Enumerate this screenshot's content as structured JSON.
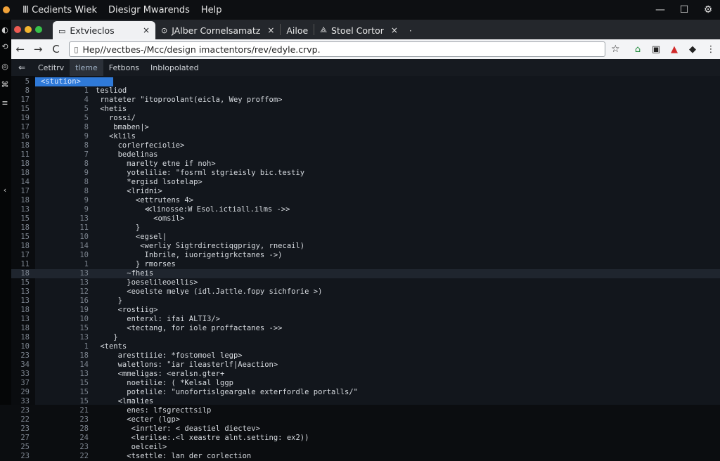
{
  "menubar": {
    "items": [
      "Ⅲ Cedients Wiek",
      "Diesigr Mwarends",
      "Help"
    ]
  },
  "window_controls": {
    "minimize": "—",
    "maximize": "☐",
    "settings": "⚙"
  },
  "left_rail": {
    "glyphs": [
      "◐",
      "⟲",
      "◎",
      "⌘",
      "≡",
      "‹"
    ]
  },
  "browser": {
    "tabs": [
      {
        "label": "Extvieclos",
        "close": "×",
        "active": true
      },
      {
        "label": "JAlber Cornelsamatz",
        "close": "×",
        "icon": "⊙"
      },
      {
        "label": "Ailoe"
      },
      {
        "label": "Stoel Cortor",
        "close": "×",
        "icon": "⟁"
      },
      {
        "label": "·"
      }
    ],
    "url": "Hep//vectbes-/Mcc/design imactentors/rev/edyle.crvp.",
    "nav": {
      "back": "←",
      "forward": "→",
      "reload": "C"
    }
  },
  "editor": {
    "back": "⇐",
    "tabs": [
      "Cetitrv",
      "tleme",
      "Fetbons",
      "Inblopolated"
    ],
    "active_tab": 1,
    "lines": [
      {
        "n": "5",
        "i": "",
        "t": "<stution>",
        "selected": true
      },
      {
        "n": "8",
        "i": "1",
        "t": "tesliod"
      },
      {
        "n": "17",
        "i": "4",
        "t": " rnateter \"itoproolant(eicla, Wey proffom>"
      },
      {
        "n": "15",
        "i": "5",
        "t": " <hetis"
      },
      {
        "n": "19",
        "i": "5",
        "t": "   rossi/"
      },
      {
        "n": "17",
        "i": "8",
        "t": "    bmaben|>"
      },
      {
        "n": "16",
        "i": "9",
        "t": "   <klils"
      },
      {
        "n": "18",
        "i": "8",
        "t": "     corlerfeciolie>"
      },
      {
        "n": "11",
        "i": "7",
        "t": "     bedelinas"
      },
      {
        "n": "18",
        "i": "8",
        "t": "       marelty etne if noh>"
      },
      {
        "n": "18",
        "i": "9",
        "t": "       yotelilie: \"fosrml stgrieisly bic.testiy"
      },
      {
        "n": "14",
        "i": "8",
        "t": "       *ergisd lsotelap>"
      },
      {
        "n": "17",
        "i": "8",
        "t": "       <lridni>"
      },
      {
        "n": "18",
        "i": "9",
        "t": "         <ettrutens 4>"
      },
      {
        "n": "13",
        "i": "9",
        "t": "           ≪linosse:W Esol.ictiall.ilms ->>"
      },
      {
        "n": "15",
        "i": "13",
        "t": "             <omsil>"
      },
      {
        "n": "18",
        "i": "11",
        "t": "         }"
      },
      {
        "n": "15",
        "i": "10",
        "t": "         <egsel|"
      },
      {
        "n": "18",
        "i": "14",
        "t": "          <werliy Sigtrdirectiqgprigy, rnecail)"
      },
      {
        "n": "17",
        "i": "10",
        "t": "           Inbrile, iuorigetigrkctanes ->)"
      },
      {
        "n": "11",
        "i": "1",
        "t": "         } rmorses"
      },
      {
        "n": "18",
        "i": "13",
        "t": "       ~fheis",
        "highlight": true
      },
      {
        "n": "15",
        "i": "13",
        "t": "       }oeselileoellis>"
      },
      {
        "n": "13",
        "i": "12",
        "t": "       <eoelste melye (idl.Jattle.fopy sichforie >)"
      },
      {
        "n": "13",
        "i": "16",
        "t": "     }"
      },
      {
        "n": "18",
        "i": "19",
        "t": "     <rostiig>"
      },
      {
        "n": "13",
        "i": "10",
        "t": "       enterxl: ifai ALTI3/>"
      },
      {
        "n": "18",
        "i": "15",
        "t": "       <tectang, for iole proffactanes ->>"
      },
      {
        "n": "18",
        "i": "13",
        "t": "    }"
      },
      {
        "n": "10",
        "i": "1",
        "t": " <tents"
      },
      {
        "n": "23",
        "i": "18",
        "t": "     aresttiiie: *fostomoel legp>"
      },
      {
        "n": "34",
        "i": "14",
        "t": "     waletlons: \"iar ileasterlf|Aeaction>"
      },
      {
        "n": "33",
        "i": "13",
        "t": "     <mmeligas: <eralsn.gter+"
      },
      {
        "n": "37",
        "i": "15",
        "t": "       noetilie: ( *Kelsal lggp"
      },
      {
        "n": "29",
        "i": "15",
        "t": "       potelile: \"unofortislgeargale exterfordle portalls/\""
      },
      {
        "n": "33",
        "i": "15",
        "t": "     <lmalies"
      },
      {
        "n": "23",
        "i": "21",
        "t": "       enes: lfsgrecttsilp"
      },
      {
        "n": "22",
        "i": "23",
        "t": "       <ecter (lgp>"
      },
      {
        "n": "23",
        "i": "28",
        "t": "        <inrtler: < deastiel diectev>"
      },
      {
        "n": "27",
        "i": "24",
        "t": "        <lerilse:.<l xeastre alnt.setting: ex2))"
      },
      {
        "n": "25",
        "i": "23",
        "t": "        oelceil>"
      },
      {
        "n": "23",
        "i": "22",
        "t": "       <tsettle: lan der corlection"
      }
    ]
  }
}
